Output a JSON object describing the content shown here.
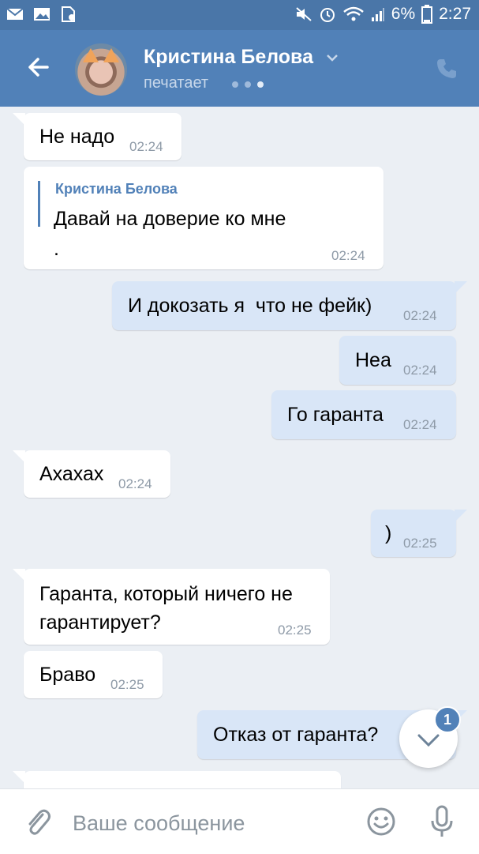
{
  "status_bar": {
    "battery": "6%",
    "time": "2:27",
    "icons": [
      "mail-icon",
      "image-icon",
      "file-icon",
      "mute-icon",
      "alarm-icon",
      "wifi-icon",
      "signal-icon",
      "battery-icon"
    ]
  },
  "header": {
    "contact_name": "Кристина Белова",
    "status": "печатает",
    "icons": [
      "back-arrow-icon",
      "chevron-down-icon",
      "phone-icon"
    ]
  },
  "messages": [
    {
      "dir": "in",
      "text": "Не надо",
      "time": "02:24"
    },
    {
      "dir": "in",
      "reply_author": "Кристина Белова",
      "text": "Давай на доверие ко мне\n.",
      "time": "02:24"
    },
    {
      "dir": "out",
      "text": "И докозать я  что не фейк)",
      "time": "02:24"
    },
    {
      "dir": "out",
      "text": "Неа",
      "time": "02:24"
    },
    {
      "dir": "out",
      "text": "Го гаранта",
      "time": "02:24"
    },
    {
      "dir": "in",
      "text": "Ахахах",
      "time": "02:24"
    },
    {
      "dir": "out",
      "text": ")",
      "time": "02:25"
    },
    {
      "dir": "in",
      "text": "Гаранта, который ничего не\nгарантирует?",
      "time": "02:25"
    },
    {
      "dir": "in",
      "text": "Браво",
      "time": "02:25"
    },
    {
      "dir": "out",
      "text": "Отказ от гаранта?",
      "time": ""
    }
  ],
  "scroll_down": {
    "unread_count": "1"
  },
  "composer": {
    "placeholder": "Ваше сообщение",
    "icons": [
      "attach-icon",
      "emoji-icon",
      "microphone-icon"
    ]
  },
  "colors": {
    "header": "#5181b8",
    "statusbar": "#4a76a8",
    "background": "#ebeff4",
    "outgoing": "#d9e6f7",
    "incoming": "#ffffff",
    "accent": "#5181b8"
  }
}
